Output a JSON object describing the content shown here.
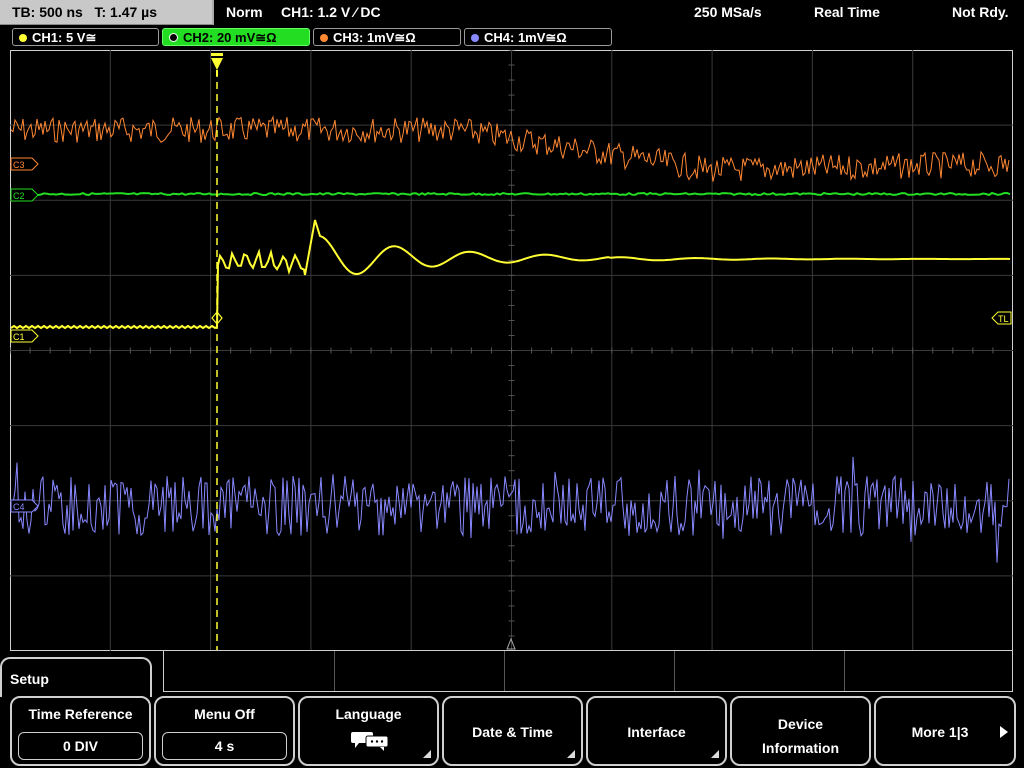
{
  "status": {
    "timebase": "TB: 500 ns",
    "trigger_time": "T: 1.47 µs",
    "mode": "Norm",
    "trigger": "CH1: 1.2 V ⁄ DC",
    "sample_rate": "250 MSa/s",
    "acq_mode": "Real Time",
    "state": "Not Rdy."
  },
  "channels": [
    {
      "label": "CH1: 5 V≅",
      "color": "#ffff33"
    },
    {
      "label": "CH2: 20 mV≅Ω",
      "color": "#22dd22",
      "active": true
    },
    {
      "label": "CH3: 1mV≅Ω",
      "color": "#ff8833"
    },
    {
      "label": "CH4: 1mV≅Ω",
      "color": "#8888ff"
    }
  ],
  "markers": {
    "c3": "C3",
    "c2": "C2",
    "c1": "C1",
    "c4": "C4",
    "trigger_level": "TL"
  },
  "menu": {
    "title": "Setup",
    "softkeys": [
      {
        "label": "Time Reference",
        "value": "0 DIV"
      },
      {
        "label": "Menu Off",
        "value": "4 s"
      },
      {
        "label": "Language",
        "icon": "speech-bubble-icon"
      },
      {
        "label": "Date & Time"
      },
      {
        "label": "Interface"
      },
      {
        "label": "Device Information"
      },
      {
        "label": "More 1|3"
      }
    ]
  }
}
